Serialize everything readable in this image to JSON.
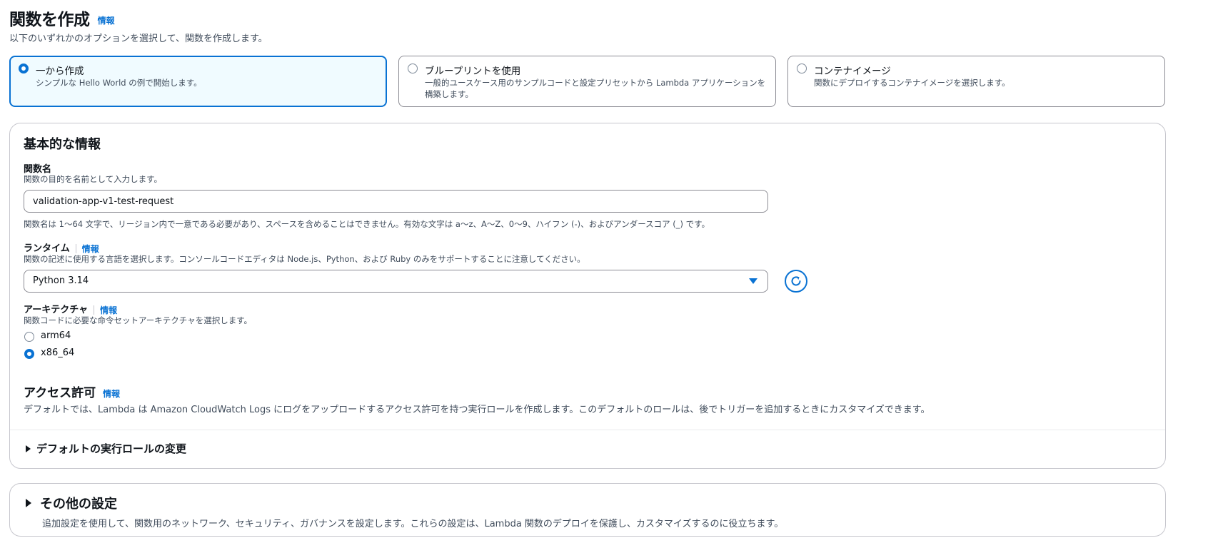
{
  "header": {
    "title": "関数を作成",
    "info": "情報",
    "description": "以下のいずれかのオプションを選択して、関数を作成します。"
  },
  "options": [
    {
      "label": "一から作成",
      "description": "シンプルな Hello World の例で開始します。",
      "selected": true
    },
    {
      "label": "ブループリントを使用",
      "description": "一般的ユースケース用のサンプルコードと設定プリセットから Lambda アプリケーションを構築します。",
      "selected": false
    },
    {
      "label": "コンテナイメージ",
      "description": "関数にデプロイするコンテナイメージを選択します。",
      "selected": false
    }
  ],
  "basic": {
    "title": "基本的な情報",
    "function_name": {
      "label": "関数名",
      "description": "関数の目的を名前として入力します。",
      "value": "validation-app-v1-test-request",
      "constraint": "関数名は 1〜64 文字で、リージョン内で一意である必要があり、スペースを含めることはできません。有効な文字は a〜z、A〜Z、0〜9、ハイフン (-)、およびアンダースコア (_) です。"
    },
    "runtime": {
      "label": "ランタイム",
      "info": "情報",
      "description": "関数の記述に使用する言語を選択します。コンソールコードエディタは Node.js、Python、および Ruby のみをサポートすることに注意してください。",
      "value": "Python 3.14"
    },
    "architecture": {
      "label": "アーキテクチャ",
      "info": "情報",
      "description": "関数コードに必要な命令セットアーキテクチャを選択します。",
      "options": [
        {
          "label": "arm64",
          "selected": false
        },
        {
          "label": "x86_64",
          "selected": true
        }
      ]
    },
    "permissions": {
      "title": "アクセス許可",
      "info": "情報",
      "description": "デフォルトでは、Lambda は Amazon CloudWatch Logs にログをアップロードするアクセス許可を持つ実行ロールを作成します。このデフォルトのロールは、後でトリガーを追加するときにカスタマイズできます。"
    },
    "role_expander": "デフォルトの実行ロールの変更"
  },
  "other": {
    "title": "その他の設定",
    "description": "追加設定を使用して、関数用のネットワーク、セキュリティ、ガバナンスを設定します。これらの設定は、Lambda 関数のデプロイを保護し、カスタマイズするのに役立ちます。"
  },
  "colors": {
    "accent": "#0972d3",
    "selected_tile_bg": "#f0fbff"
  }
}
